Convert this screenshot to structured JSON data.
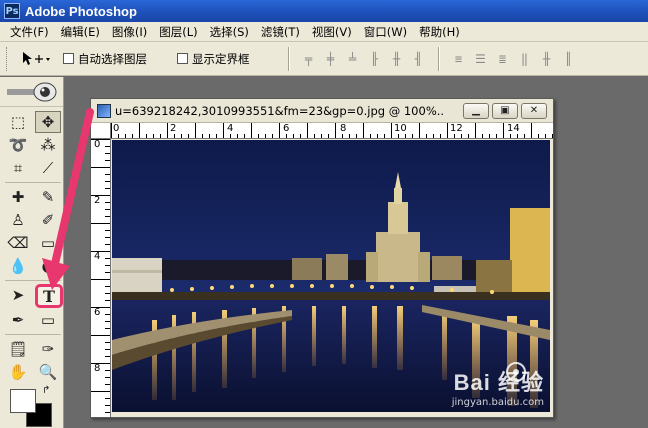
{
  "window": {
    "title": "Adobe Photoshop"
  },
  "menu": [
    "文件(F)",
    "编辑(E)",
    "图像(I)",
    "图层(L)",
    "选择(S)",
    "滤镜(T)",
    "视图(V)",
    "窗口(W)",
    "帮助(H)"
  ],
  "options": {
    "auto_select_label": "自动选择图层",
    "show_bounds_label": "显示定界框"
  },
  "document": {
    "title": "u=639218242,3010993551&fm=23&gp=0.jpg @ 100%...",
    "ruler_h": [
      "0",
      "2",
      "4",
      "6",
      "8",
      "10",
      "12",
      "14"
    ],
    "ruler_v": [
      "0",
      "2",
      "4",
      "6",
      "8"
    ]
  },
  "toolbox": {
    "type_tool_glyph": "T"
  },
  "watermark": {
    "logo": "Bai 经验",
    "url": "jingyan.baidu.com"
  },
  "colors": {
    "annotation": "#e8366e",
    "titlebar": "#1d4fb8"
  }
}
